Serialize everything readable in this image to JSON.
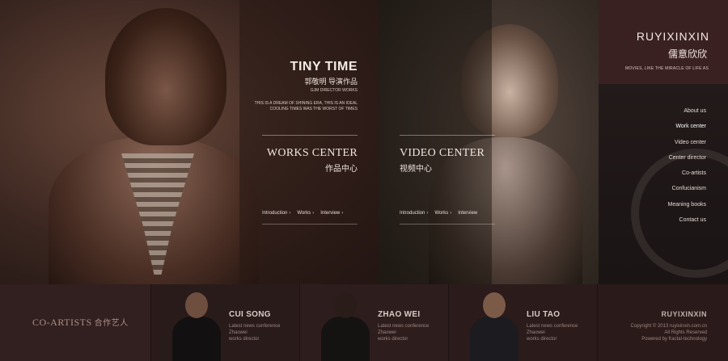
{
  "hero": {
    "tiny_time": {
      "title": "TINY TIME",
      "subtitle_cn": "郭敬明 导演作品",
      "subtitle_en": "GJM DIRECTOR WORKS",
      "desc_line1": "THIS IS A DREAM OF SHINING ERA, THIS IS AN IDEAL",
      "desc_line2": "COOLING TIMES WAS THE WORST OF TIMES"
    },
    "works": {
      "title": "WORKS CENTER",
      "title_cn": "作品中心",
      "links": [
        "Introduction",
        "Works",
        "Interview"
      ]
    },
    "video": {
      "title": "VIDEO CENTER",
      "title_cn": "视频中心",
      "links": [
        "Introduction",
        "Works",
        "Interview"
      ]
    }
  },
  "sidebar": {
    "logo_en": "RUYIXINXIN",
    "logo_cn": "儒意欣欣",
    "motto": "MOVIES, LIKE THE MIRACLE OF LIFE AS",
    "nav": [
      "About us",
      "Work center",
      "Video center",
      "Center director",
      "Co-artists",
      "Confucianism",
      "Meaning books",
      "Contact us"
    ],
    "active_index": 1
  },
  "bottom": {
    "co_title": "CO-ARTISTS",
    "co_title_cn": "合作艺人",
    "artists": [
      {
        "name": "CUI SONG",
        "line1": "Latest news conference",
        "line2": "Zhaowei",
        "line3": "works director"
      },
      {
        "name": "ZHAO WEI",
        "line1": "Latest news conference",
        "line2": "Zhaowei",
        "line3": "works director"
      },
      {
        "name": "LIU TAO",
        "line1": "Latest news conference",
        "line2": "Zhaowei",
        "line3": "works director"
      }
    ],
    "footer": {
      "brand": "RUYIXINXIN",
      "copy1": "Copyright © 2013 ruyixinxin.com.cn",
      "copy2": "All Rights Reserved",
      "copy3": "Powered by fractal-technology"
    }
  }
}
